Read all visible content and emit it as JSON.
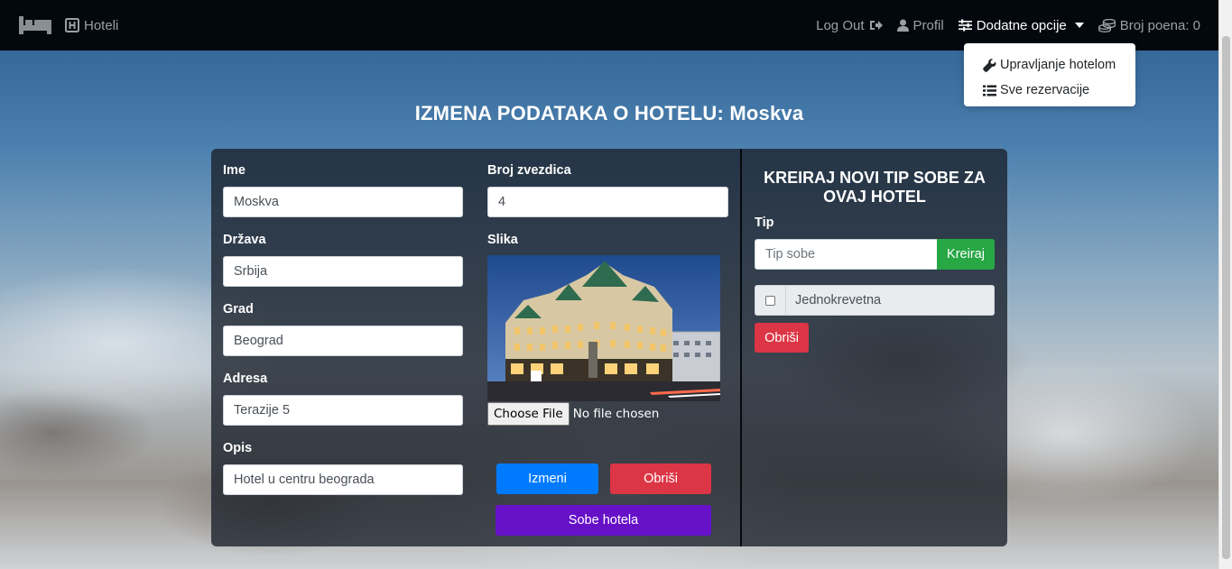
{
  "navbar": {
    "brand_icon": "bed-icon",
    "hotels_label": "Hoteli",
    "logout_label": "Log Out",
    "profile_label": "Profil",
    "options_label": "Dodatne opcije",
    "points_label": "Broj poena: 0"
  },
  "dropdown": {
    "items": [
      {
        "label": "Upravljanje hotelom",
        "icon": "wrench-icon"
      },
      {
        "label": "Sve rezervacije",
        "icon": "list-icon"
      }
    ]
  },
  "page": {
    "title": "IZMENA PODATAKA O HOTELU: Moskva"
  },
  "form": {
    "name_label": "Ime",
    "name_value": "Moskva",
    "country_label": "Država",
    "country_value": "Srbija",
    "city_label": "Grad",
    "city_value": "Beograd",
    "address_label": "Adresa",
    "address_value": "Terazije 5",
    "description_label": "Opis",
    "description_value": "Hotel u centru beograda",
    "stars_label": "Broj zvezdica",
    "stars_value": "4",
    "image_label": "Slika",
    "file_button": "Choose File",
    "file_status": "No file chosen",
    "edit_button": "Izmeni",
    "delete_button": "Obriši",
    "rooms_button": "Sobe hotela"
  },
  "room_types": {
    "title": "KREIRAJ NOVI TIP SOBE ZA OVAJ HOTEL",
    "type_label": "Tip",
    "type_placeholder": "Tip sobe",
    "create_button": "Kreiraj",
    "items": [
      {
        "label": "Jednokrevetna",
        "checked": false
      }
    ],
    "delete_button": "Obriši"
  },
  "colors": {
    "navbar_bg": "#03080e",
    "primary": "#007bff",
    "danger": "#dc3545",
    "success": "#28a745",
    "purple": "#6610c8"
  }
}
